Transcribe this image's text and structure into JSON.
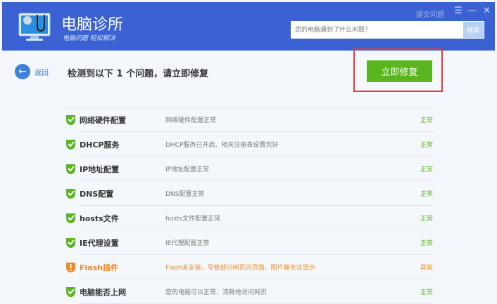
{
  "header": {
    "title": "电脑诊所",
    "subtitle": "电脑问题 轻松解决",
    "submit_link": "提交问题",
    "menu_icon": "☰",
    "minimize_icon": "—",
    "close_icon": "✕",
    "search": {
      "placeholder": "您的电脑遇到了什么问题？",
      "button": "搜索"
    }
  },
  "toolbar": {
    "back_label": "返回",
    "headline": "检测到以下 1 个问题，请立即修复",
    "fix_button": "立即修复"
  },
  "colors": {
    "header": "#3a62d2",
    "ok": "#5ab51e",
    "warn": "#ee8a22",
    "highlight": "#e53a3a"
  },
  "items": [
    {
      "name": "网络硬件配置",
      "desc": "网络硬件配置正常",
      "status": "正常",
      "state": "ok"
    },
    {
      "name": "DHCP服务",
      "desc": "DHCP服务已开启、相关注册表设置完好",
      "status": "正常",
      "state": "ok"
    },
    {
      "name": "IP地址配置",
      "desc": "IP地址配置正常",
      "status": "正常",
      "state": "ok"
    },
    {
      "name": "DNS配置",
      "desc": "DNS配置正常",
      "status": "正常",
      "state": "ok"
    },
    {
      "name": "hosts文件",
      "desc": "hosts文件配置正常",
      "status": "正常",
      "state": "ok"
    },
    {
      "name": "IE代理设置",
      "desc": "IE代理配置正常",
      "status": "正常",
      "state": "ok"
    },
    {
      "name": "Flash插件",
      "desc": "Flash未安装，导致部分网页的页面、图片等无法显示",
      "status": "异常",
      "state": "warn"
    },
    {
      "name": "电脑能否上网",
      "desc": "您的电脑可以正常、流畅地访问网页",
      "status": "正常",
      "state": "ok"
    }
  ]
}
